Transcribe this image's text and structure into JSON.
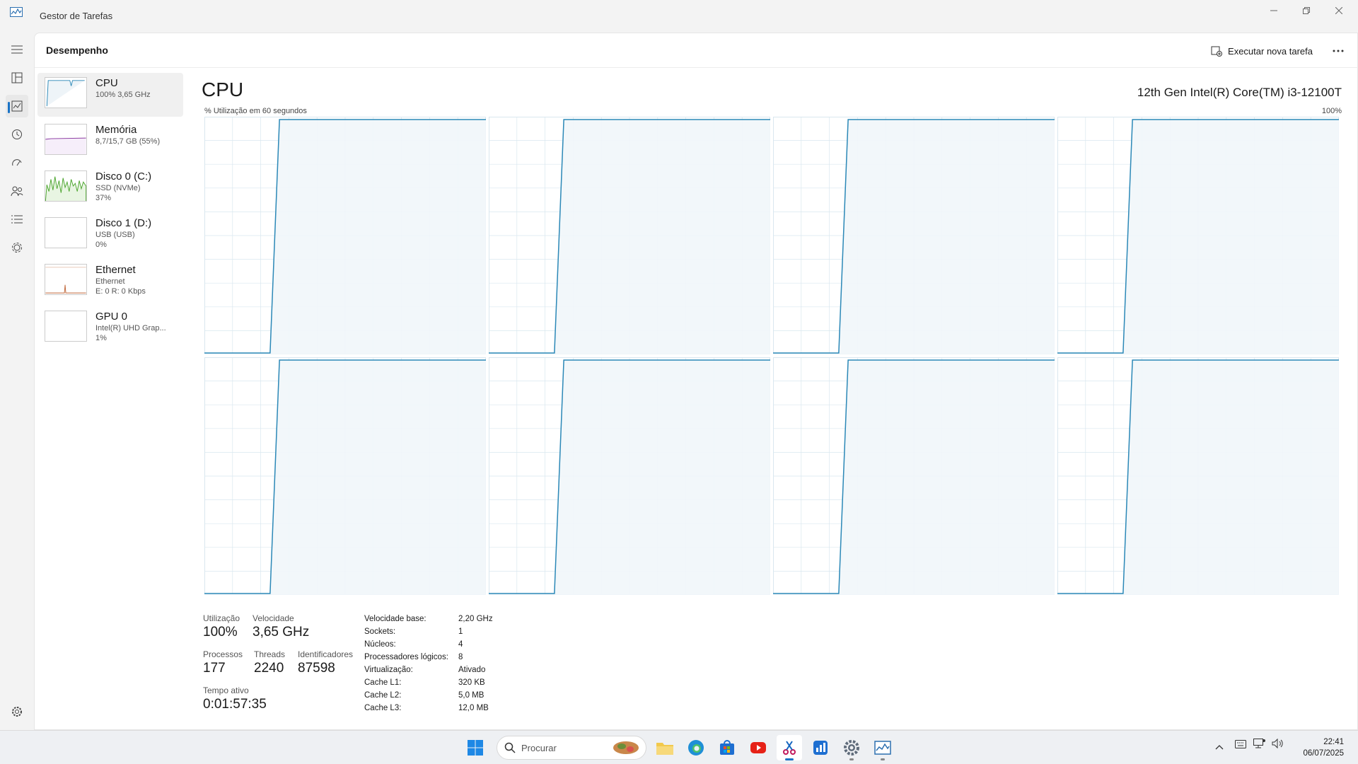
{
  "window": {
    "title": "Gestor de Tarefas"
  },
  "header": {
    "title": "Desempenho",
    "run_task_label": "Executar nova tarefa"
  },
  "nav": [
    {
      "name": "menu",
      "icon": "hamburger-icon"
    },
    {
      "name": "processes",
      "icon": "processes-icon"
    },
    {
      "name": "performance",
      "icon": "performance-icon",
      "active": true
    },
    {
      "name": "app-history",
      "icon": "history-icon"
    },
    {
      "name": "startup",
      "icon": "startup-icon"
    },
    {
      "name": "users",
      "icon": "users-icon"
    },
    {
      "name": "details",
      "icon": "details-icon"
    },
    {
      "name": "services",
      "icon": "services-icon"
    },
    {
      "name": "settings",
      "icon": "gear-icon"
    }
  ],
  "devices": [
    {
      "name": "CPU",
      "line2": "100% 3,65 GHz",
      "line3": "",
      "color": "#2b88b7"
    },
    {
      "name": "Memória",
      "line2": "8,7/15,7 GB (55%)",
      "line3": "",
      "color": "#8b3aa0"
    },
    {
      "name": "Disco 0 (C:)",
      "line2": "SSD (NVMe)",
      "line3": "37%",
      "color": "#4ca52e"
    },
    {
      "name": "Disco 1 (D:)",
      "line2": "USB (USB)",
      "line3": "0%",
      "color": "#4ca52e"
    },
    {
      "name": "Ethernet",
      "line2": "Ethernet",
      "line3": "E: 0 R: 0 Kbps",
      "color": "#c0683b"
    },
    {
      "name": "GPU 0",
      "line2": "Intel(R) UHD Grap...",
      "line3": "1%",
      "color": "#2b88b7"
    }
  ],
  "cpu": {
    "title": "CPU",
    "model": "12th Gen Intel(R) Core(TM) i3-12100T",
    "graph_label": "% Utilização em 60 segundos",
    "graph_max": "100%",
    "line_color": "#2b88b7",
    "fill_color": "#f1f6f9",
    "grid_color": "#d9e7ef"
  },
  "stats": {
    "util_label": "Utilização",
    "util": "100%",
    "speed_label": "Velocidade",
    "speed": "3,65 GHz",
    "proc_label": "Processos",
    "proc": "177",
    "threads_label": "Threads",
    "threads": "2240",
    "handles_label": "Identificadores",
    "handles": "87598",
    "uptime_label": "Tempo ativo",
    "uptime": "0:01:57:35"
  },
  "details": [
    {
      "k": "Velocidade base:",
      "v": "2,20 GHz"
    },
    {
      "k": "Sockets:",
      "v": "1"
    },
    {
      "k": "Núcleos:",
      "v": "4"
    },
    {
      "k": "Processadores lógicos:",
      "v": "8"
    },
    {
      "k": "Virtualização:",
      "v": "Ativado"
    },
    {
      "k": "Cache L1:",
      "v": "320 KB"
    },
    {
      "k": "Cache L2:",
      "v": "5,0 MB"
    },
    {
      "k": "Cache L3:",
      "v": "12,0 MB"
    }
  ],
  "taskbar": {
    "search_placeholder": "Procurar",
    "time": "22:41",
    "date": "06/07/2025"
  },
  "chart_data": {
    "type": "line",
    "title": "% Utilização em 60 segundos",
    "ylim": [
      0,
      100
    ],
    "x": [
      0,
      2,
      4,
      6,
      8,
      10,
      12,
      14,
      16,
      18,
      20,
      22,
      24,
      26,
      28,
      30,
      32,
      34,
      36,
      38,
      40,
      42,
      44,
      46,
      48,
      50,
      52,
      54,
      56,
      58,
      60
    ],
    "series": [
      {
        "values": [
          0,
          0,
          0,
          0,
          0,
          0,
          0,
          0,
          100,
          100,
          100,
          100,
          100,
          100,
          100,
          100,
          100,
          100,
          100,
          100,
          100,
          100,
          100,
          100,
          100,
          100,
          100,
          100,
          100,
          100,
          100
        ]
      },
      {
        "values": [
          0,
          0,
          0,
          0,
          0,
          0,
          0,
          0,
          100,
          100,
          100,
          100,
          100,
          100,
          100,
          100,
          100,
          100,
          100,
          100,
          100,
          100,
          100,
          100,
          100,
          100,
          100,
          100,
          100,
          100,
          100
        ]
      },
      {
        "values": [
          0,
          0,
          0,
          0,
          0,
          0,
          0,
          0,
          100,
          100,
          100,
          100,
          100,
          100,
          100,
          100,
          100,
          100,
          100,
          100,
          100,
          100,
          100,
          100,
          100,
          100,
          100,
          100,
          100,
          100,
          100
        ]
      },
      {
        "values": [
          0,
          0,
          0,
          0,
          0,
          0,
          0,
          0,
          100,
          100,
          100,
          100,
          100,
          100,
          100,
          100,
          100,
          100,
          100,
          100,
          100,
          100,
          100,
          100,
          100,
          100,
          100,
          100,
          100,
          100,
          100
        ]
      },
      {
        "values": [
          0,
          0,
          0,
          0,
          0,
          0,
          0,
          0,
          100,
          100,
          100,
          100,
          100,
          100,
          100,
          100,
          100,
          100,
          100,
          100,
          100,
          100,
          100,
          100,
          100,
          100,
          100,
          100,
          100,
          100,
          100
        ]
      },
      {
        "values": [
          0,
          0,
          0,
          0,
          0,
          0,
          0,
          0,
          100,
          100,
          100,
          100,
          100,
          100,
          100,
          100,
          100,
          100,
          100,
          100,
          100,
          100,
          100,
          100,
          100,
          100,
          100,
          100,
          100,
          100,
          100
        ]
      },
      {
        "values": [
          0,
          0,
          0,
          0,
          0,
          0,
          0,
          0,
          100,
          100,
          100,
          100,
          100,
          100,
          100,
          100,
          100,
          100,
          100,
          100,
          100,
          100,
          100,
          100,
          100,
          100,
          100,
          100,
          100,
          100,
          100
        ]
      },
      {
        "values": [
          0,
          0,
          0,
          0,
          0,
          0,
          0,
          0,
          100,
          100,
          100,
          100,
          100,
          100,
          100,
          100,
          100,
          100,
          100,
          100,
          100,
          100,
          100,
          100,
          100,
          100,
          100,
          100,
          100,
          100,
          100
        ]
      }
    ]
  }
}
